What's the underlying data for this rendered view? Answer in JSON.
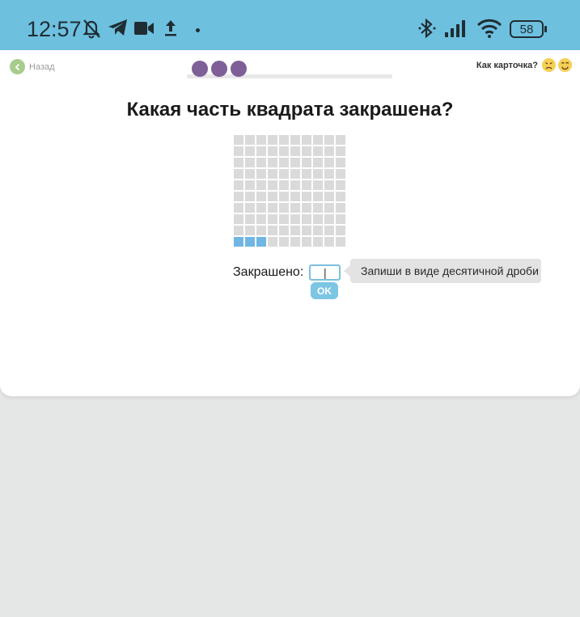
{
  "statusbar": {
    "time": "12:57",
    "left_icons": [
      "bell-off-icon",
      "telegram-icon",
      "video-camera-icon",
      "upload-icon"
    ],
    "right_icons": [
      "bluetooth-icon",
      "signal-icon",
      "wifi-icon"
    ],
    "battery": "58"
  },
  "nav": {
    "back_label": "Назад",
    "progress_dots": 3,
    "rating_label": "Как карточка?",
    "rating_icons": [
      "sad-face-icon",
      "smiling-face-icon"
    ]
  },
  "task": {
    "question": "Какая часть квадрата закрашена?",
    "grid": {
      "rows": 10,
      "cols": 10,
      "shaded_cells": 3
    },
    "answer_label": "Закрашено:",
    "answer_value": "",
    "answer_placeholder": "|",
    "hint": "Запиши в виде десятичной дроби",
    "ok_label": "OK"
  },
  "colors": {
    "statusbar": "#6ec0df",
    "progress": "#7e5f97",
    "shaded": "#6fb6e2",
    "cell": "#dadada",
    "button": "#7cc5e3",
    "back": "#a7cc8c"
  }
}
